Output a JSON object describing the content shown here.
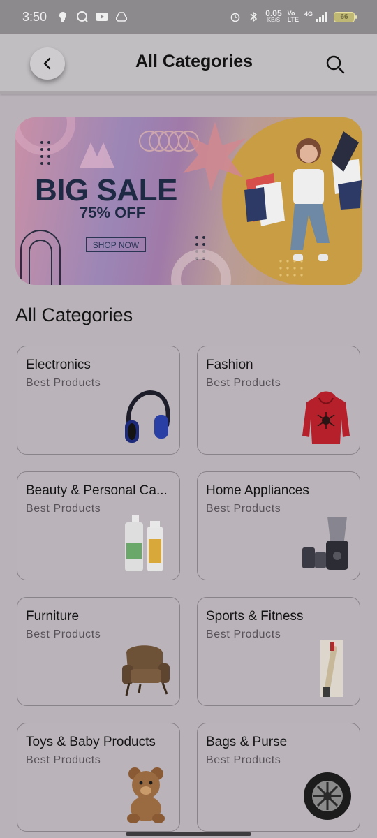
{
  "status_bar": {
    "time": "3:50",
    "net_speed_value": "0.05",
    "net_speed_unit": "KB/S",
    "volte_top": "Vo",
    "volte_bottom": "LTE",
    "network_type": "4G",
    "battery": "66"
  },
  "header": {
    "title": "All Categories"
  },
  "banner": {
    "title": "BIG SALE",
    "subtitle": "75% OFF",
    "cta": "SHOP NOW"
  },
  "section": {
    "title": "All Categories"
  },
  "categories": [
    {
      "name": "Electronics",
      "subtitle": "Best Products",
      "icon": "headphones-icon"
    },
    {
      "name": "Fashion",
      "subtitle": "Best Products",
      "icon": "hoodie-icon"
    },
    {
      "name": "Beauty & Personal Ca...",
      "subtitle": "Best Products",
      "icon": "cosmetics-icon"
    },
    {
      "name": "Home Appliances",
      "subtitle": "Best Products",
      "icon": "mixer-grinder-icon"
    },
    {
      "name": "Furniture",
      "subtitle": "Best Products",
      "icon": "armchair-icon"
    },
    {
      "name": "Sports & Fitness",
      "subtitle": "Best Products",
      "icon": "cricket-bat-icon"
    },
    {
      "name": "Toys & Baby Products",
      "subtitle": "Best Products",
      "icon": "teddy-bear-icon"
    },
    {
      "name": "Bags & Purse",
      "subtitle": "Best Products",
      "icon": "tyre-icon"
    }
  ],
  "colors": {
    "overlay_background": "#b9b3b9",
    "banner_accent": "#c89d43",
    "sale_text": "#1e2a44"
  }
}
